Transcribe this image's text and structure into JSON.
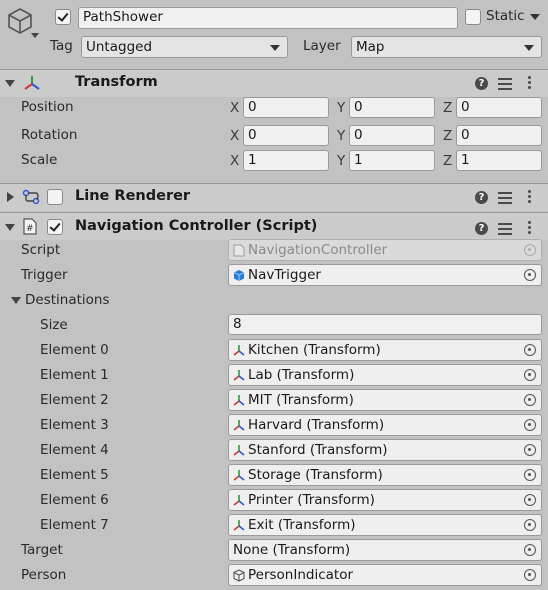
{
  "object": {
    "name": "PathShower",
    "active": true,
    "static_label": "Static",
    "static_checked": false,
    "tag_label": "Tag",
    "tag_value": "Untagged",
    "layer_label": "Layer",
    "layer_value": "Map"
  },
  "transform": {
    "title": "Transform",
    "rows": [
      {
        "label": "Position",
        "x": "0",
        "y": "0",
        "z": "0"
      },
      {
        "label": "Rotation",
        "x": "0",
        "y": "0",
        "z": "0"
      },
      {
        "label": "Scale",
        "x": "1",
        "y": "1",
        "z": "1"
      }
    ],
    "axis_x": "X",
    "axis_y": "Y",
    "axis_z": "Z"
  },
  "line_renderer": {
    "title": "Line Renderer",
    "enabled": false
  },
  "nav_controller": {
    "title": "Navigation Controller (Script)",
    "enabled": true,
    "script_label": "Script",
    "script_value": "NavigationController",
    "trigger_label": "Trigger",
    "trigger_value": "NavTrigger",
    "destinations_label": "Destinations",
    "size_label": "Size",
    "size_value": "8",
    "elements": [
      {
        "label": "Element 0",
        "value": "Kitchen (Transform)"
      },
      {
        "label": "Element 1",
        "value": "Lab (Transform)"
      },
      {
        "label": "Element 2",
        "value": "MIT (Transform)"
      },
      {
        "label": "Element 3",
        "value": "Harvard (Transform)"
      },
      {
        "label": "Element 4",
        "value": "Stanford (Transform)"
      },
      {
        "label": "Element 5",
        "value": "Storage (Transform)"
      },
      {
        "label": "Element 6",
        "value": "Printer (Transform)"
      },
      {
        "label": "Element 7",
        "value": "Exit (Transform)"
      }
    ],
    "target_label": "Target",
    "target_value": "None (Transform)",
    "person_label": "Person",
    "person_value": "PersonIndicator"
  },
  "colors": {
    "background": "#c2c2c2",
    "transform_x": "#d03a2a",
    "transform_y": "#2a9a3a",
    "transform_z": "#2a5ad0",
    "prefab_blue": "#2a7ad8"
  }
}
